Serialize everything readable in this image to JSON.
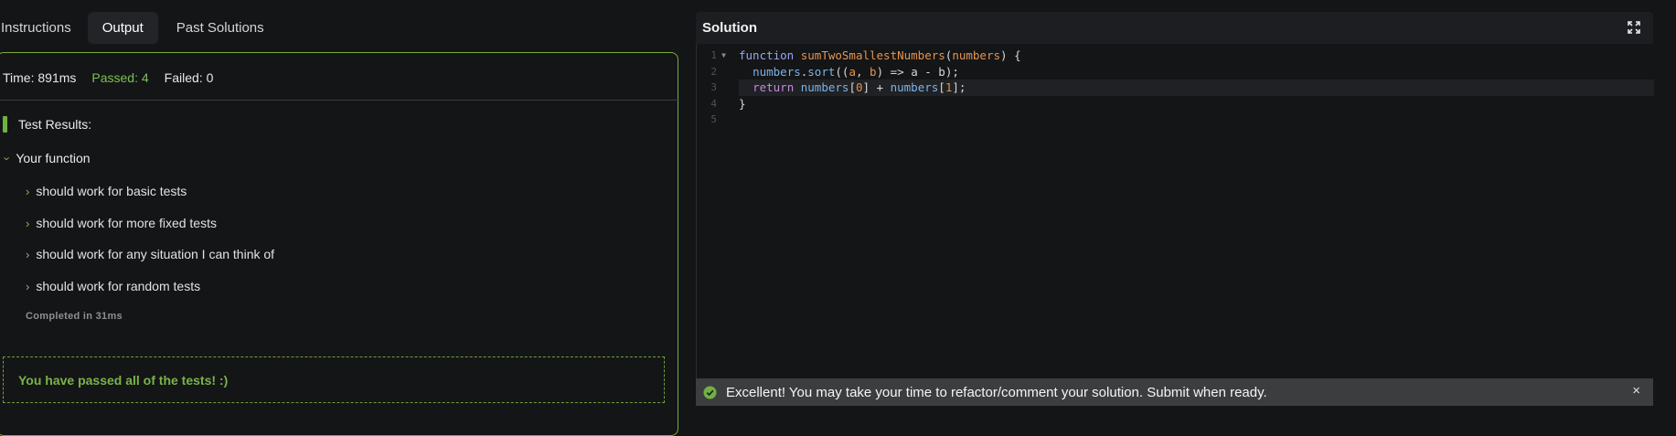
{
  "tabs": [
    {
      "label": "Instructions"
    },
    {
      "label": "Output"
    },
    {
      "label": "Past Solutions"
    }
  ],
  "stats": {
    "time": "Time: 891ms",
    "passed": "Passed: 4",
    "failed": "Failed: 0"
  },
  "results": {
    "title": "Test Results:",
    "describe": "Your function",
    "tests": [
      {
        "label": "should work for basic tests"
      },
      {
        "label": "should work for more fixed tests"
      },
      {
        "label": "should work for any situation I can think of"
      },
      {
        "label": "should work for random tests"
      }
    ],
    "completed": "Completed in 31ms",
    "pass_message": "You have passed all of the tests! :)"
  },
  "solution": {
    "title": "Solution",
    "line_numbers": [
      "1",
      "2",
      "3",
      "4",
      "5"
    ],
    "code": {
      "l1_kw": "function",
      "l1_fn": "sumTwoSmallestNumbers",
      "l1_p1": "(",
      "l1_param": "numbers",
      "l1_p2": ") {",
      "l2_indent": "  ",
      "l2_obj": "numbers",
      "l2_dot": ".",
      "l2_method": "sort",
      "l2_open": "((",
      "l2_a": "a",
      "l2_comma": ", ",
      "l2_b": "b",
      "l2_rest": ") => a - b);",
      "l3_indent": "  ",
      "l3_kw": "return",
      "l3_sp": " ",
      "l3_obj1": "numbers",
      "l3_b1": "[",
      "l3_n1": "0",
      "l3_b2": "] + ",
      "l3_obj2": "numbers",
      "l3_b3": "[",
      "l3_n2": "1",
      "l3_b4": "];",
      "l4": "}"
    }
  },
  "status": {
    "message": "Excellent! You may take your time to refactor/comment your solution. Submit when ready.",
    "close_glyph": "×"
  },
  "colors": {
    "accent_green": "#7cc054",
    "border_green": "#7cab3c",
    "background": "#141517"
  },
  "icons": {
    "expand": "expand-icon",
    "check": "check-circle-icon",
    "close": "close-icon",
    "chevron": "chevron-right-icon"
  }
}
